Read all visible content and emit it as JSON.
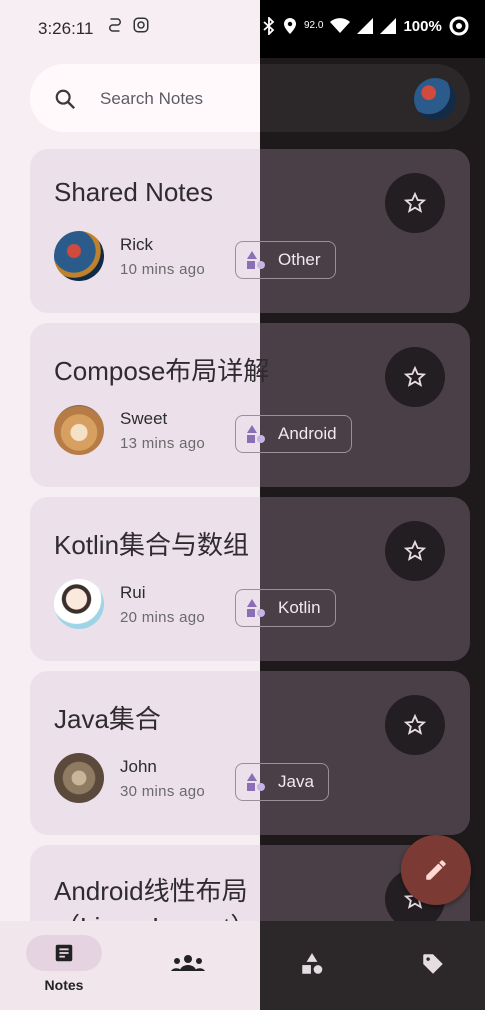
{
  "status_bar": {
    "time": "3:26:11",
    "net_speed": "92.0",
    "battery": "100%"
  },
  "search": {
    "placeholder": "Search Notes"
  },
  "notes": [
    {
      "title": "Shared Notes",
      "author": "Rick",
      "time": "10 mins ago",
      "tag": "Other"
    },
    {
      "title": "Compose布局详解",
      "author": "Sweet",
      "time": "13 mins ago",
      "tag": "Android"
    },
    {
      "title": "Kotlin集合与数组",
      "author": "Rui",
      "time": "20 mins ago",
      "tag": "Kotlin"
    },
    {
      "title": "Java集合",
      "author": "John",
      "time": "30 mins ago",
      "tag": "Java"
    },
    {
      "title": "Android线性布局（LinearLayout）"
    }
  ],
  "bottom_nav": {
    "notes_label": "Notes"
  },
  "colors": {
    "light_bg": "#f6eef2",
    "dark_bg": "#1e1a1c",
    "card_light": "#ece0ea",
    "card_dark": "#4a3f46",
    "fab": "#7b3b34"
  }
}
